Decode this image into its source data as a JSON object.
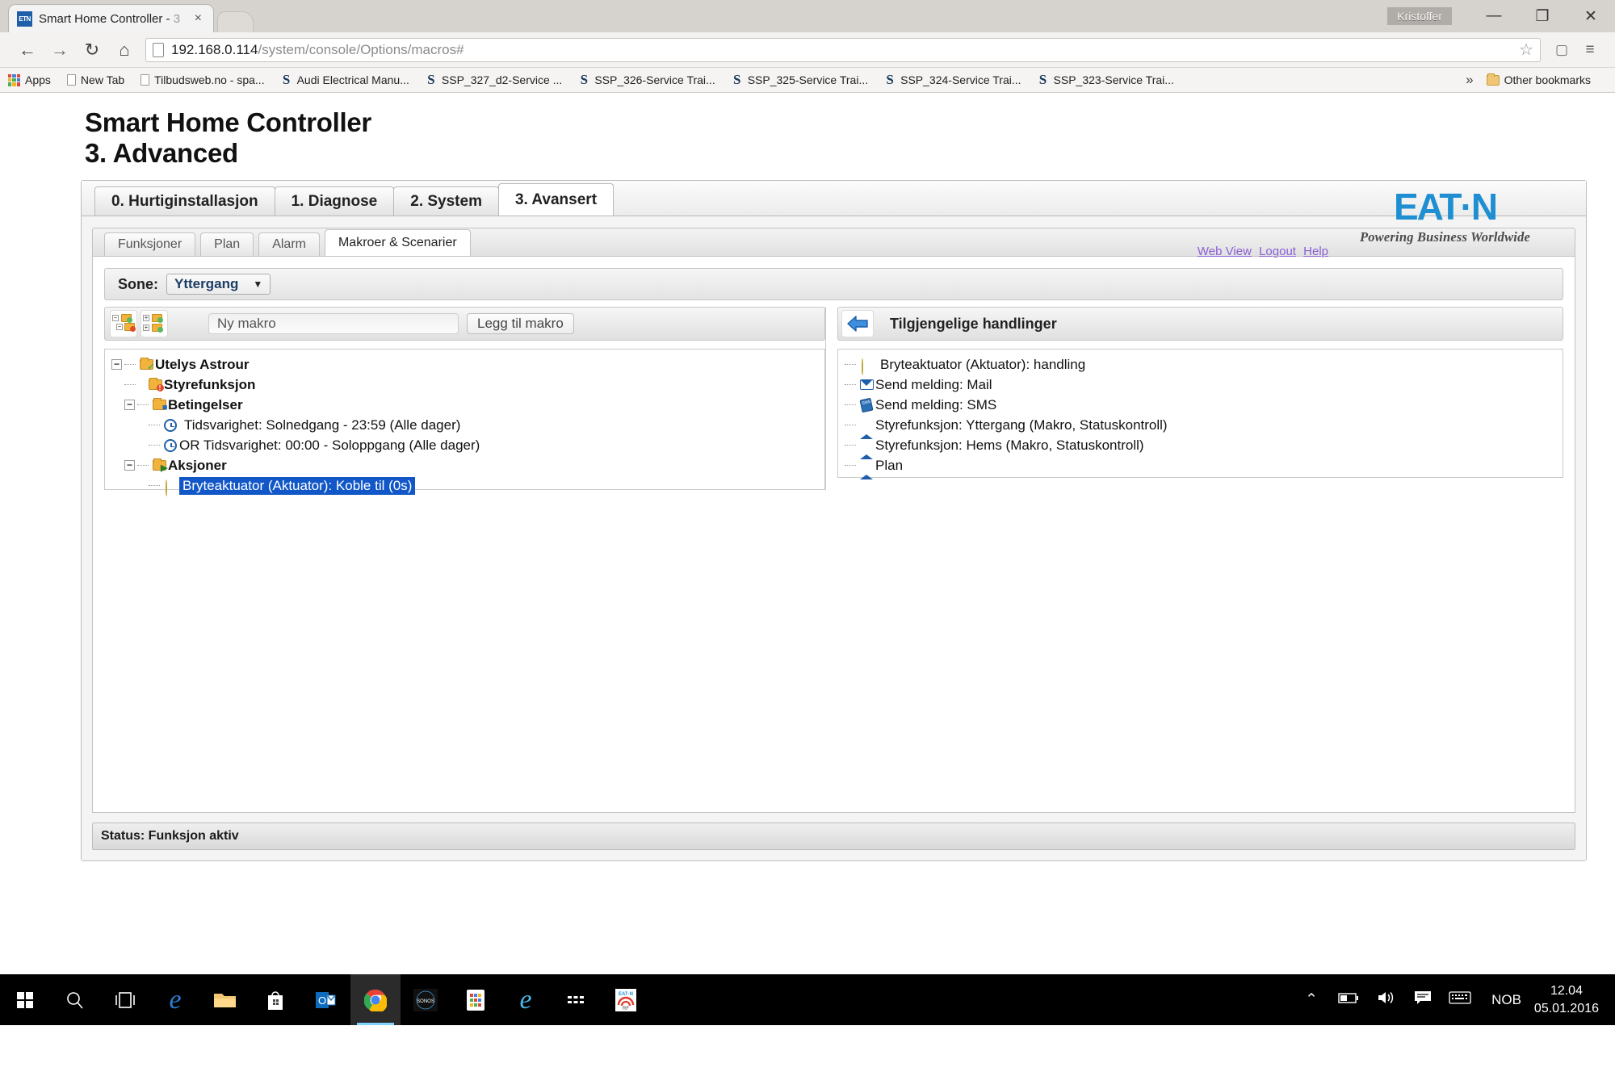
{
  "browser": {
    "tab": {
      "favicon_text": "ETN",
      "title": "Smart Home Controller - ",
      "title_dim": "3",
      "close": "×"
    },
    "window": {
      "user": "Kristoffer",
      "minimize": "—",
      "restore": "❐",
      "close": "✕"
    },
    "nav": {
      "back": "←",
      "forward": "→",
      "reload": "↻",
      "home": "⌂"
    },
    "omnibox": {
      "url_host": "192.168.0.114",
      "url_path": "/system/console/Options/macros#",
      "star": "☆",
      "cast": "▢",
      "menu": "≡"
    },
    "bookmarks": {
      "apps_label": "Apps",
      "items": [
        {
          "label": "New Tab",
          "icon": "doc-icon"
        },
        {
          "label": "Tilbudsweb.no - spa...",
          "icon": "doc-icon"
        },
        {
          "label": "Audi Electrical Manu...",
          "icon": "s-icon"
        },
        {
          "label": "SSP_327_d2-Service ...",
          "icon": "s-icon"
        },
        {
          "label": "SSP_326-Service Trai...",
          "icon": "s-icon"
        },
        {
          "label": "SSP_325-Service Trai...",
          "icon": "s-icon"
        },
        {
          "label": "SSP_324-Service Trai...",
          "icon": "s-icon"
        },
        {
          "label": "SSP_323-Service Trai...",
          "icon": "s-icon"
        }
      ],
      "overflow": "»",
      "other_bookmarks": "Other bookmarks"
    }
  },
  "page": {
    "title": "Smart Home Controller",
    "subtitle": "3. Advanced",
    "links": [
      {
        "label": "Web View"
      },
      {
        "label": "Logout"
      },
      {
        "label": "Help"
      }
    ],
    "logo": {
      "word": "EAT·N",
      "tagline": "Powering Business Worldwide",
      "color": "#1f8fd1"
    },
    "main_tabs": [
      {
        "label": "0. Hurtiginstallasjon",
        "active": false
      },
      {
        "label": "1. Diagnose",
        "active": false
      },
      {
        "label": "2. System",
        "active": false
      },
      {
        "label": "3. Avansert",
        "active": true
      }
    ],
    "sub_tabs": [
      {
        "label": "Funksjoner",
        "active": false
      },
      {
        "label": "Plan",
        "active": false
      },
      {
        "label": "Alarm",
        "active": false
      },
      {
        "label": "Makroer & Scenarier",
        "active": true
      }
    ],
    "zone": {
      "label": "Sone:",
      "value": "Yttergang",
      "caret": "▼"
    },
    "left_toolbar": {
      "collapse_icon": "collapse-tree-icon",
      "expand_icon": "expand-tree-icon",
      "new_macro_placeholder": "Ny makro",
      "add_macro_label": "Legg til makro"
    },
    "right_toolbar": {
      "back_arrow": "←",
      "title": "Tilgjengelige handlinger"
    },
    "tree": [
      {
        "label": "Utelys Astrour",
        "bold": true,
        "indent": 0,
        "expander": "−",
        "icon": "folder-check-icon"
      },
      {
        "label": "Styrefunksjon",
        "bold": true,
        "indent": 1,
        "expander": "",
        "icon": "folder-alert-icon"
      },
      {
        "label": "Betingelser",
        "bold": true,
        "indent": 1,
        "expander": "−",
        "icon": "folder-conditions-icon"
      },
      {
        "label": "Tidsvarighet: Solnedgang - 23:59 (Alle dager)",
        "bold": false,
        "indent": 2,
        "expander": "",
        "icon": "clock-icon"
      },
      {
        "label": "OR Tidsvarighet: 00:00 - Soloppgang (Alle dager)",
        "bold": false,
        "indent": 2,
        "expander": "",
        "icon": "clock-icon"
      },
      {
        "label": "Aksjoner",
        "bold": true,
        "indent": 1,
        "expander": "−",
        "icon": "folder-actions-icon"
      },
      {
        "label": "Bryteaktuator (Aktuator): Koble til (0s)",
        "bold": false,
        "indent": 2,
        "expander": "",
        "icon": "bulb-icon",
        "selected": true
      }
    ],
    "available_actions": [
      {
        "label": "Bryteaktuator (Aktuator): handling",
        "icon": "bulb-icon"
      },
      {
        "label": "Send melding: Mail",
        "icon": "mail-icon"
      },
      {
        "label": "Send melding: SMS",
        "icon": "sms-icon"
      },
      {
        "label": "Styrefunksjon: Yttergang (Makro, Statuskontroll)",
        "icon": "house-icon"
      },
      {
        "label": "Styrefunksjon: Hems (Makro, Statuskontroll)",
        "icon": "house-icon"
      },
      {
        "label": "Plan",
        "icon": "house-icon"
      }
    ],
    "status": "Status: Funksjon aktiv",
    "selection_color": "#1257c8"
  },
  "taskbar": {
    "items": [
      {
        "name": "start-button",
        "glyph": "start"
      },
      {
        "name": "search-icon",
        "glyph": "⌕"
      },
      {
        "name": "task-view-icon",
        "glyph": "▢"
      },
      {
        "name": "edge-icon",
        "glyph": "e"
      },
      {
        "name": "file-explorer-icon",
        "glyph": "folder"
      },
      {
        "name": "microsoft-store-icon",
        "glyph": "bag"
      },
      {
        "name": "outlook-icon",
        "glyph": "O"
      },
      {
        "name": "chrome-icon",
        "glyph": "chrome",
        "active": true
      },
      {
        "name": "sonos-icon",
        "glyph": "SONOS"
      },
      {
        "name": "app-tiles-icon",
        "glyph": "tiles"
      },
      {
        "name": "internet-explorer-icon",
        "glyph": "e"
      },
      {
        "name": "deezer-icon",
        "glyph": "•••"
      },
      {
        "name": "eaton-rf-icon",
        "glyph": "RF"
      }
    ],
    "tray": {
      "chevron": "⌃",
      "battery": "▭",
      "volume": "🔊",
      "action_center": "🖨",
      "keyboard": "⌨",
      "language": "NOB",
      "time": "12.04",
      "date": "05.01.2016"
    }
  }
}
